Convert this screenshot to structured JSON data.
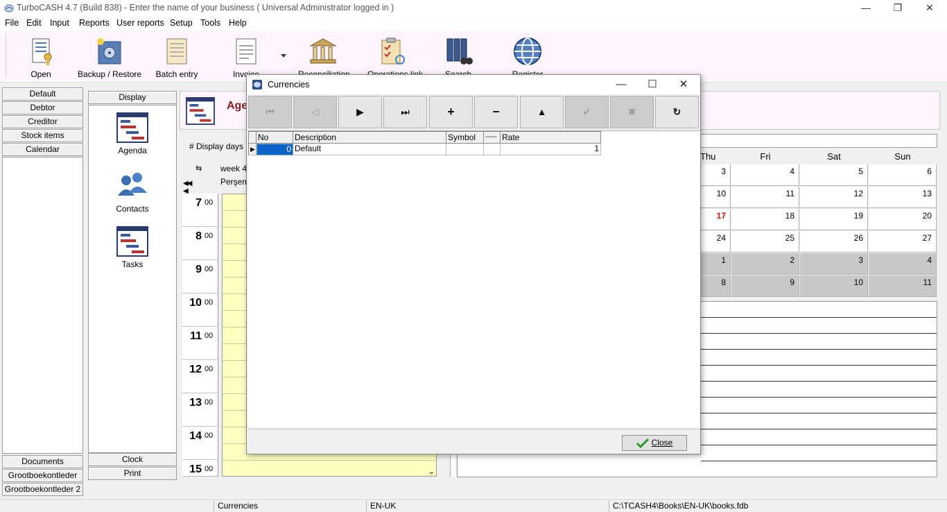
{
  "app": {
    "title": "TurboCASH 4.7 (Build 838)  - Enter the name of your business ( Universal Administrator logged in )",
    "controls": {
      "minimize": "—",
      "restore": "❐",
      "close": "✕"
    }
  },
  "menu": [
    "File",
    "Edit",
    "Input",
    "Reports",
    "User reports",
    "Setup",
    "Tools",
    "Help"
  ],
  "toolbar": {
    "open": "Open",
    "backup": "Backup / Restore",
    "batch": "Batch entry",
    "invoice": "Invoice",
    "reconciliation": "Reconciliation",
    "operations": "Operations link",
    "search": "Search",
    "register": "Register"
  },
  "leftnav": {
    "top": [
      "Default",
      "Debtor",
      "Creditor",
      "Stock items",
      "Calendar"
    ],
    "bottom": [
      "Documents",
      "Grootboekontleder",
      "Grootboekontleder 2"
    ]
  },
  "display": {
    "header": "Display",
    "items": [
      "Agenda",
      "Contacts",
      "Tasks"
    ],
    "clock": "Clock",
    "print": "Print"
  },
  "agenda": {
    "title": "Agenda",
    "display_days": "# Display days",
    "week": "week  4",
    "day_label": "Perşembe",
    "hours": [
      "7",
      "8",
      "9",
      "10",
      "11",
      "12",
      "13",
      "14",
      "15"
    ],
    "minutes": "00"
  },
  "calendar": {
    "days": [
      "Thu",
      "Fri",
      "Sat",
      "Sun"
    ],
    "rows": [
      [
        "3",
        "4",
        "5",
        "6"
      ],
      [
        "10",
        "11",
        "12",
        "13"
      ],
      [
        "17",
        "18",
        "19",
        "20"
      ],
      [
        "24",
        "25",
        "26",
        "27"
      ],
      [
        "1",
        "2",
        "3",
        "4"
      ],
      [
        "8",
        "9",
        "10",
        "11"
      ]
    ],
    "today": "17",
    "today_color": "#d01010"
  },
  "dialog": {
    "title": "Currencies",
    "nav": [
      "first-icon",
      "prior-icon",
      "next-icon",
      "last-icon",
      "insert-icon",
      "delete-icon",
      "edit-icon",
      "post-icon",
      "cancel-icon",
      "refresh-icon"
    ],
    "columns": [
      "No",
      "Description",
      "Symbol",
      "-----",
      "Rate"
    ],
    "rows": [
      {
        "no": "0",
        "description": "Default",
        "symbol": "",
        "extra": "",
        "rate": "1"
      }
    ],
    "close": "Close"
  },
  "statusbar": {
    "form": "Currencies",
    "lang": "EN-UK",
    "path": "C:\\TCASH4\\Books\\EN-UK\\books.fdb"
  },
  "colors": {
    "accent": "#8b1a1a",
    "selection": "#0a64c8",
    "toolbar_bg": "#fdf5fd",
    "agenda_bg": "#ffffc2"
  }
}
